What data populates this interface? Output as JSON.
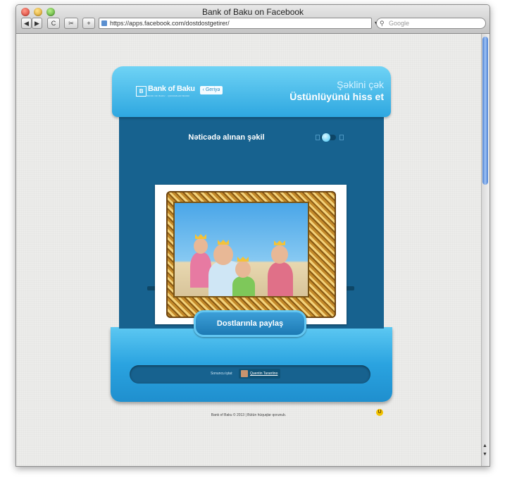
{
  "window": {
    "title": "Bank of Baku on Facebook"
  },
  "toolbar": {
    "back": "◀",
    "forward": "▶",
    "reload": "C",
    "snap": "✂",
    "add": "+",
    "url": "https://apps.facebook.com/dostdostgetirer/",
    "search_placeholder": "Google"
  },
  "app": {
    "logo_text": "Bank of Baku",
    "logo_mark": "B",
    "logo_tagline": "BANK OF BAKU · QURUMLAR BANKI",
    "back_label": "‹ Geriyə",
    "header_light": "Şəklini çək",
    "header_main": "Üstünlüyünü hiss et",
    "result_label": "Nəticədə alınan şəkil",
    "share_label": "Dostlarınla paylaş",
    "last_label": "Sonuncu iştai:",
    "last_user": "Quentin Tarantino"
  },
  "footer": {
    "copyright": "Bank of Baku © 2013 | Bütün hüquqlar qorunub.",
    "badge": "U"
  },
  "colors": {
    "cap_blue": "#2ea7e0",
    "body_blue": "#17628f",
    "share_border": "#63c7f2"
  }
}
